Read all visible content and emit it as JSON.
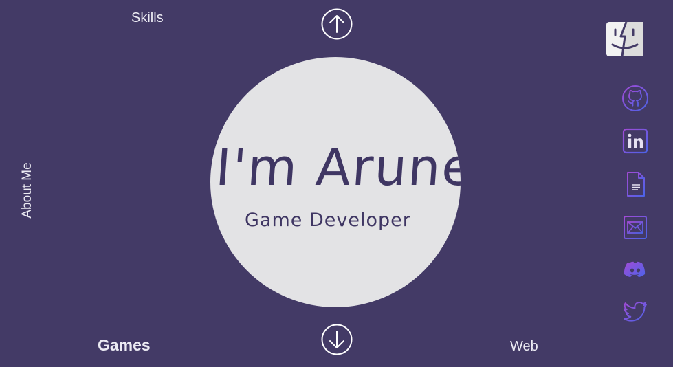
{
  "nav": {
    "skills": "Skills",
    "about": "About Me",
    "games": "Games",
    "web": "Web"
  },
  "hero": {
    "name": "I'm Arune",
    "role": "Game Developer"
  },
  "icons": {
    "logo": "finder-face-icon",
    "up": "arrow-up-circle-icon",
    "down": "arrow-down-circle-icon",
    "social": [
      "github-icon",
      "linkedin-icon",
      "resume-document-icon",
      "email-icon",
      "discord-icon",
      "twitter-icon"
    ]
  },
  "colors": {
    "background": "#433a66",
    "circle": "#e3e3e5",
    "text_dark": "#3f3663",
    "icon_gradient_start": "#a24bd6",
    "icon_gradient_end": "#4c63e8"
  }
}
